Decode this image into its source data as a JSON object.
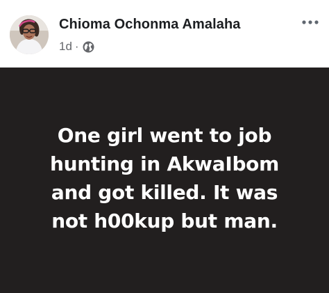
{
  "post": {
    "author": "Chioma Ochonma Amalaha",
    "timestamp": "1d",
    "separator": "·",
    "audience_icon": "globe-icon",
    "more_icon": "more-options-icon",
    "text_lines": [
      "One girl went to job",
      "hunting in AkwaIbom",
      "and got killed. It was",
      "not h00kup but man."
    ],
    "colors": {
      "card_background": "#221f1f",
      "post_text": "#ffffff",
      "author_text": "#1c1e21",
      "meta_text": "#65676b"
    }
  }
}
